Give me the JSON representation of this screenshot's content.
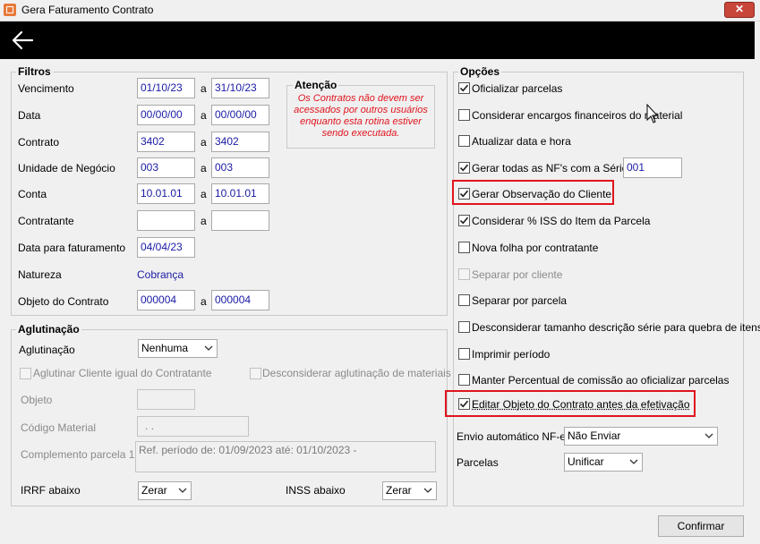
{
  "window": {
    "title": "Gera Faturamento Contrato",
    "close_glyph": "✕"
  },
  "filtros": {
    "legend": "Filtros",
    "separator": "a",
    "rows": {
      "vencimento": {
        "label": "Vencimento",
        "from": "01/10/23",
        "to": "31/10/23"
      },
      "data": {
        "label": "Data",
        "from": "00/00/00",
        "to": "00/00/00"
      },
      "contrato": {
        "label": "Contrato",
        "from": "3402",
        "to": "3402"
      },
      "unidade": {
        "label": "Unidade de Negócio",
        "from": "003",
        "to": "003"
      },
      "conta": {
        "label": "Conta",
        "from": "10.01.01",
        "to": "10.01.01"
      },
      "contratante": {
        "label": "Contratante",
        "from": "",
        "to": ""
      },
      "data_faturamento": {
        "label": "Data para faturamento",
        "value": "04/04/23"
      },
      "natureza": {
        "label": "Natureza",
        "value": "Cobrança"
      },
      "objeto": {
        "label": "Objeto do Contrato",
        "from": "000004",
        "to": "000004"
      }
    },
    "atencao": {
      "title": "Atenção",
      "line1": "Os Contratos não devem ser",
      "line2": "acessados por outros usuários",
      "line3": "enquanto esta rotina estiver",
      "line4": "sendo executada."
    }
  },
  "aglutinacao": {
    "legend": "Aglutinação",
    "aglutinacao_label": "Aglutinação",
    "aglutinacao_value": "Nenhuma",
    "aglutinar_cliente": "Aglutinar Cliente igual do Contratante",
    "desconsiderar_materiais": "Desconsiderar aglutinação de materiais",
    "objeto_label": "Objeto",
    "codigo_material_label": "Código Material",
    "codigo_material_value": ". .",
    "complemento_label": "Complemento parcela 1",
    "complemento_value": "Ref. período de: 01/09/2023 até: 01/10/2023 -",
    "irrf_label": "IRRF abaixo",
    "irrf_value": "Zerar",
    "inss_label": "INSS abaixo",
    "inss_value": "Zerar"
  },
  "opcoes": {
    "legend": "Opções",
    "items": [
      {
        "label": "Oficializar parcelas",
        "checked": true
      },
      {
        "label": "Considerar encargos financeiros do material",
        "checked": false
      },
      {
        "label": "Atualizar data e hora",
        "checked": false
      },
      {
        "label": "Gerar todas as NF's com a Série",
        "checked": true
      },
      {
        "label": "Gerar Observação do Cliente",
        "checked": true
      },
      {
        "label": "Considerar % ISS do Item da Parcela",
        "checked": true
      },
      {
        "label": "Nova folha por contratante",
        "checked": false
      },
      {
        "label": "Separar por cliente",
        "checked": false
      },
      {
        "label": "Separar por parcela",
        "checked": false
      },
      {
        "label": "Desconsiderar tamanho descrição série para quebra de itens",
        "checked": false
      },
      {
        "label": "Imprimir período",
        "checked": false
      },
      {
        "label": "Manter Percentual de comissão ao oficializar parcelas",
        "checked": false
      },
      {
        "label": "Editar Objeto do Contrato antes da efetivação",
        "checked": true
      }
    ],
    "serie_value": "001",
    "envio_label": "Envio automático NF-e",
    "envio_value": "Não Enviar",
    "parcelas_label": "Parcelas",
    "parcelas_value": "Unificar"
  },
  "footer": {
    "confirm_label": "Confirmar"
  },
  "colors": {
    "highlight": "#e0141e",
    "link_text": "#1a1aa6",
    "toolbar": "#000000"
  }
}
